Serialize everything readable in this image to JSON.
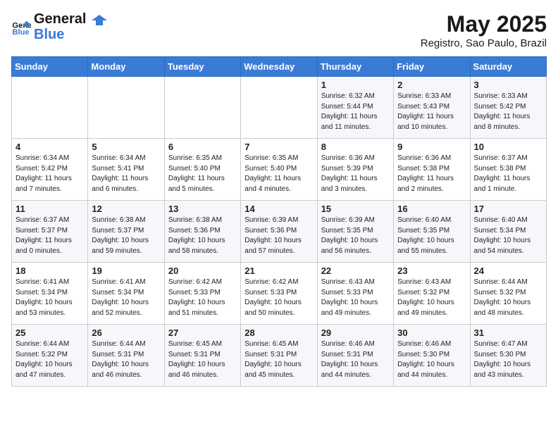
{
  "header": {
    "logo_general": "General",
    "logo_blue": "Blue",
    "month_year": "May 2025",
    "location": "Registro, Sao Paulo, Brazil"
  },
  "days_of_week": [
    "Sunday",
    "Monday",
    "Tuesday",
    "Wednesday",
    "Thursday",
    "Friday",
    "Saturday"
  ],
  "weeks": [
    [
      {
        "day": "",
        "sunrise": "",
        "sunset": "",
        "daylight": ""
      },
      {
        "day": "",
        "sunrise": "",
        "sunset": "",
        "daylight": ""
      },
      {
        "day": "",
        "sunrise": "",
        "sunset": "",
        "daylight": ""
      },
      {
        "day": "",
        "sunrise": "",
        "sunset": "",
        "daylight": ""
      },
      {
        "day": "1",
        "sunrise": "Sunrise: 6:32 AM",
        "sunset": "Sunset: 5:44 PM",
        "daylight": "Daylight: 11 hours and 11 minutes."
      },
      {
        "day": "2",
        "sunrise": "Sunrise: 6:33 AM",
        "sunset": "Sunset: 5:43 PM",
        "daylight": "Daylight: 11 hours and 10 minutes."
      },
      {
        "day": "3",
        "sunrise": "Sunrise: 6:33 AM",
        "sunset": "Sunset: 5:42 PM",
        "daylight": "Daylight: 11 hours and 8 minutes."
      }
    ],
    [
      {
        "day": "4",
        "sunrise": "Sunrise: 6:34 AM",
        "sunset": "Sunset: 5:42 PM",
        "daylight": "Daylight: 11 hours and 7 minutes."
      },
      {
        "day": "5",
        "sunrise": "Sunrise: 6:34 AM",
        "sunset": "Sunset: 5:41 PM",
        "daylight": "Daylight: 11 hours and 6 minutes."
      },
      {
        "day": "6",
        "sunrise": "Sunrise: 6:35 AM",
        "sunset": "Sunset: 5:40 PM",
        "daylight": "Daylight: 11 hours and 5 minutes."
      },
      {
        "day": "7",
        "sunrise": "Sunrise: 6:35 AM",
        "sunset": "Sunset: 5:40 PM",
        "daylight": "Daylight: 11 hours and 4 minutes."
      },
      {
        "day": "8",
        "sunrise": "Sunrise: 6:36 AM",
        "sunset": "Sunset: 5:39 PM",
        "daylight": "Daylight: 11 hours and 3 minutes."
      },
      {
        "day": "9",
        "sunrise": "Sunrise: 6:36 AM",
        "sunset": "Sunset: 5:38 PM",
        "daylight": "Daylight: 11 hours and 2 minutes."
      },
      {
        "day": "10",
        "sunrise": "Sunrise: 6:37 AM",
        "sunset": "Sunset: 5:38 PM",
        "daylight": "Daylight: 11 hours and 1 minute."
      }
    ],
    [
      {
        "day": "11",
        "sunrise": "Sunrise: 6:37 AM",
        "sunset": "Sunset: 5:37 PM",
        "daylight": "Daylight: 11 hours and 0 minutes."
      },
      {
        "day": "12",
        "sunrise": "Sunrise: 6:38 AM",
        "sunset": "Sunset: 5:37 PM",
        "daylight": "Daylight: 10 hours and 59 minutes."
      },
      {
        "day": "13",
        "sunrise": "Sunrise: 6:38 AM",
        "sunset": "Sunset: 5:36 PM",
        "daylight": "Daylight: 10 hours and 58 minutes."
      },
      {
        "day": "14",
        "sunrise": "Sunrise: 6:39 AM",
        "sunset": "Sunset: 5:36 PM",
        "daylight": "Daylight: 10 hours and 57 minutes."
      },
      {
        "day": "15",
        "sunrise": "Sunrise: 6:39 AM",
        "sunset": "Sunset: 5:35 PM",
        "daylight": "Daylight: 10 hours and 56 minutes."
      },
      {
        "day": "16",
        "sunrise": "Sunrise: 6:40 AM",
        "sunset": "Sunset: 5:35 PM",
        "daylight": "Daylight: 10 hours and 55 minutes."
      },
      {
        "day": "17",
        "sunrise": "Sunrise: 6:40 AM",
        "sunset": "Sunset: 5:34 PM",
        "daylight": "Daylight: 10 hours and 54 minutes."
      }
    ],
    [
      {
        "day": "18",
        "sunrise": "Sunrise: 6:41 AM",
        "sunset": "Sunset: 5:34 PM",
        "daylight": "Daylight: 10 hours and 53 minutes."
      },
      {
        "day": "19",
        "sunrise": "Sunrise: 6:41 AM",
        "sunset": "Sunset: 5:34 PM",
        "daylight": "Daylight: 10 hours and 52 minutes."
      },
      {
        "day": "20",
        "sunrise": "Sunrise: 6:42 AM",
        "sunset": "Sunset: 5:33 PM",
        "daylight": "Daylight: 10 hours and 51 minutes."
      },
      {
        "day": "21",
        "sunrise": "Sunrise: 6:42 AM",
        "sunset": "Sunset: 5:33 PM",
        "daylight": "Daylight: 10 hours and 50 minutes."
      },
      {
        "day": "22",
        "sunrise": "Sunrise: 6:43 AM",
        "sunset": "Sunset: 5:33 PM",
        "daylight": "Daylight: 10 hours and 49 minutes."
      },
      {
        "day": "23",
        "sunrise": "Sunrise: 6:43 AM",
        "sunset": "Sunset: 5:32 PM",
        "daylight": "Daylight: 10 hours and 49 minutes."
      },
      {
        "day": "24",
        "sunrise": "Sunrise: 6:44 AM",
        "sunset": "Sunset: 5:32 PM",
        "daylight": "Daylight: 10 hours and 48 minutes."
      }
    ],
    [
      {
        "day": "25",
        "sunrise": "Sunrise: 6:44 AM",
        "sunset": "Sunset: 5:32 PM",
        "daylight": "Daylight: 10 hours and 47 minutes."
      },
      {
        "day": "26",
        "sunrise": "Sunrise: 6:44 AM",
        "sunset": "Sunset: 5:31 PM",
        "daylight": "Daylight: 10 hours and 46 minutes."
      },
      {
        "day": "27",
        "sunrise": "Sunrise: 6:45 AM",
        "sunset": "Sunset: 5:31 PM",
        "daylight": "Daylight: 10 hours and 46 minutes."
      },
      {
        "day": "28",
        "sunrise": "Sunrise: 6:45 AM",
        "sunset": "Sunset: 5:31 PM",
        "daylight": "Daylight: 10 hours and 45 minutes."
      },
      {
        "day": "29",
        "sunrise": "Sunrise: 6:46 AM",
        "sunset": "Sunset: 5:31 PM",
        "daylight": "Daylight: 10 hours and 44 minutes."
      },
      {
        "day": "30",
        "sunrise": "Sunrise: 6:46 AM",
        "sunset": "Sunset: 5:30 PM",
        "daylight": "Daylight: 10 hours and 44 minutes."
      },
      {
        "day": "31",
        "sunrise": "Sunrise: 6:47 AM",
        "sunset": "Sunset: 5:30 PM",
        "daylight": "Daylight: 10 hours and 43 minutes."
      }
    ]
  ]
}
